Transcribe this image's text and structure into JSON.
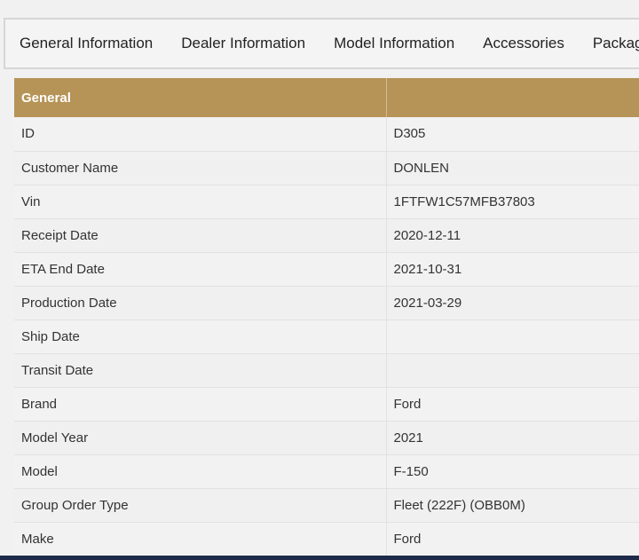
{
  "tabs": [
    {
      "label": "General Information"
    },
    {
      "label": "Dealer Information"
    },
    {
      "label": "Model Information"
    },
    {
      "label": "Accessories"
    },
    {
      "label": "Packag"
    }
  ],
  "table": {
    "header": [
      "General",
      ""
    ],
    "rows": [
      [
        "ID",
        "D305"
      ],
      [
        "Customer Name",
        "DONLEN"
      ],
      [
        "Vin",
        "1FTFW1C57MFB37803"
      ],
      [
        "Receipt Date",
        "2020-12-11"
      ],
      [
        "ETA End Date",
        "2021-10-31"
      ],
      [
        "Production Date",
        "2021-03-29"
      ],
      [
        "Ship Date",
        ""
      ],
      [
        "Transit Date",
        ""
      ],
      [
        "Brand",
        "Ford"
      ],
      [
        "Model Year",
        "2021"
      ],
      [
        "Model",
        "F-150"
      ],
      [
        "Group Order Type",
        "Fleet (222F) (OBB0M)"
      ],
      [
        "Make",
        "Ford"
      ]
    ]
  },
  "colors": {
    "header_bg": "#b69356",
    "bottom_bar": "#1e2a4a"
  }
}
